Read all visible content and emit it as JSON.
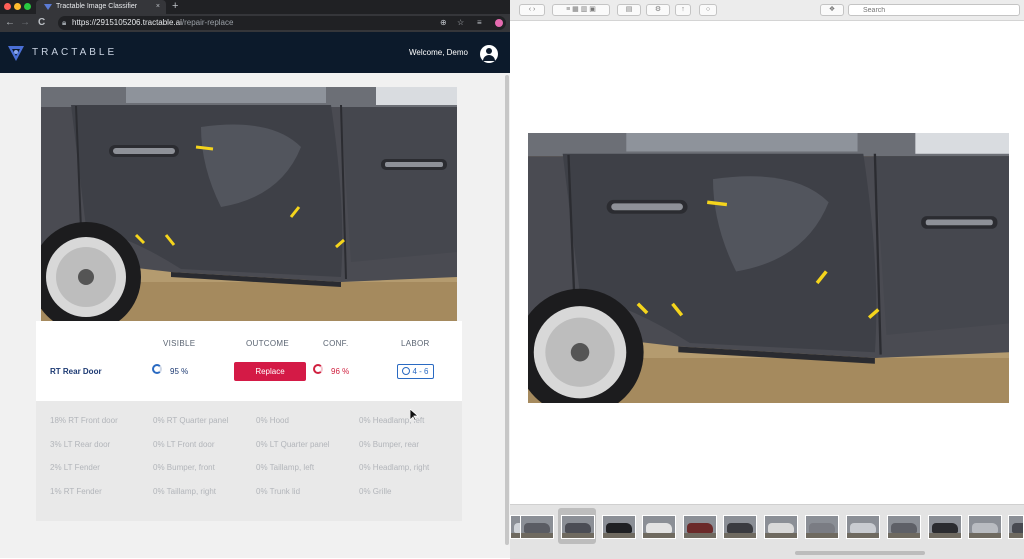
{
  "browser": {
    "tab_title": "Tractable Image Classifier",
    "tab_close": "×",
    "new_tab": "+",
    "nav": {
      "back": "←",
      "forward": "→",
      "reload": "C"
    },
    "url_host": "https://2915105206.tractable.ai",
    "url_path": "/repair-replace"
  },
  "app": {
    "brand": "TRACTABLE",
    "welcome": "Welcome, Demo"
  },
  "result": {
    "headers": {
      "visible": "VISIBLE",
      "outcome": "OUTCOME",
      "conf": "CONF.",
      "labor": "LABOR"
    },
    "part": "RT Rear Door",
    "visible_pct": "95 %",
    "visible_value": 0.95,
    "outcome": "Replace",
    "conf_pct": "96 %",
    "conf_value": 0.96,
    "labor": "4 - 6"
  },
  "other_parts": [
    [
      "18% RT Front door",
      "0% RT Quarter panel",
      "0% Hood",
      "0% Headlamp, left"
    ],
    [
      "3% LT Rear door",
      "0% LT Front door",
      "0% LT Quarter panel",
      "0% Bumper, rear"
    ],
    [
      "2% LT Fender",
      "0% Bumper, front",
      "0% Taillamp, left",
      "0% Headlamp, right"
    ],
    [
      "1% RT Fender",
      "0% Taillamp, right",
      "0% Trunk lid",
      "0% Grille"
    ]
  ],
  "preview": {
    "search_placeholder": "Search"
  },
  "colors": {
    "header_bg": "#0c1a2b",
    "accent_blue": "#2a6ac2",
    "replace_red": "#d41a46",
    "part_name": "#1d3a73"
  },
  "icons": [
    "tractable-logo-icon",
    "account-icon",
    "lock-icon",
    "search-icon",
    "star-icon",
    "extension-icon",
    "clock-icon",
    "cursor-icon",
    "gear-icon",
    "share-icon"
  ]
}
